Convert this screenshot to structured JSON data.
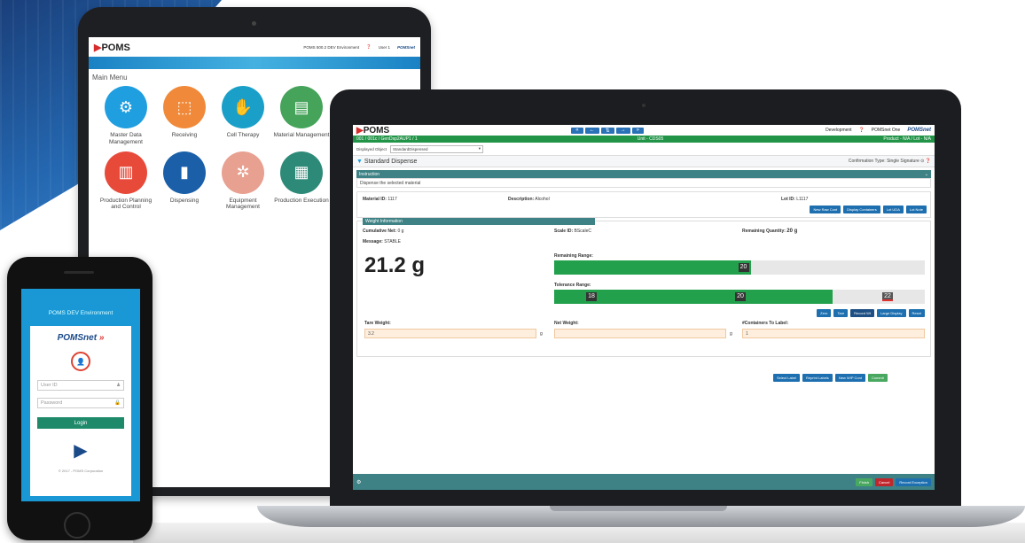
{
  "tablet": {
    "brand": "POMS",
    "env": "POMS 500.2 DEV Environment",
    "user": "User 1",
    "poms_net": "POMSnet",
    "menu_title": "Main Menu",
    "tiles": [
      {
        "label": "Master Data Management",
        "color": "#1f9ee0",
        "glyph": "⚙"
      },
      {
        "label": "Receiving",
        "color": "#f08a3a",
        "glyph": "⬚"
      },
      {
        "label": "Cell Therapy",
        "color": "#1aa0c8",
        "glyph": "✋"
      },
      {
        "label": "Material Management",
        "color": "#45a35a",
        "glyph": "▤"
      },
      {
        "label": "Production Planning and Control",
        "color": "#e84a3a",
        "glyph": "▥"
      },
      {
        "label": "Dispensing",
        "color": "#1a5fa8",
        "glyph": "▮"
      },
      {
        "label": "Equipment Management",
        "color": "#e8a090",
        "glyph": "✲"
      },
      {
        "label": "Production Execution",
        "color": "#2e8a78",
        "glyph": "▦"
      }
    ]
  },
  "phone": {
    "env": "POMS DEV Environment",
    "logo": "POMSnet",
    "user_placeholder": "User ID",
    "password_placeholder": "Password",
    "login_label": "Login",
    "copyright": "© 2017 - POMS Corporation"
  },
  "app": {
    "brand": "POMS",
    "nav": [
      "«",
      "←",
      "⇅",
      "→",
      "»"
    ],
    "environment": "Development",
    "user": "POMSnet One",
    "poms_net": "POMSnet",
    "breadcrumb": "001 / 001c / GenDsp2AUP1 / 1",
    "unit": "Unit - CDS05",
    "product": "Product - N/A / Lot - N/A",
    "displayed_object_label": "Displayed Object",
    "displayed_object_value": "StandardDispensed",
    "form_title": "Standard Dispense",
    "confirmation_label": "Confirmation Type:",
    "confirmation_value": "Single Signature",
    "instruction_header": "Instruction",
    "instruction_text": "Dispense the selected material",
    "material_id_label": "Material ID:",
    "material_id": "1117",
    "description_label": "Description:",
    "description": "Alcohol",
    "lot_id_label": "Lot ID:",
    "lot_id": "L1117",
    "material_buttons": [
      "New Raw Cont",
      "Display Containers",
      "Lot UDA",
      "Lot Note"
    ],
    "weight_header": "Weight Information",
    "cumulative_label": "Cumulative Net:",
    "cumulative_value": "0 g",
    "scale_label": "Scale ID:",
    "scale_value": "BScaleC",
    "remaining_qty_label": "Remaining Quantity:",
    "remaining_qty_value": "20 g",
    "message_label": "Message:",
    "message_value": "STABLE",
    "weight_display": "21.2 g",
    "remaining_range_label": "Remaining Range:",
    "remaining_range_fill": 0.53,
    "remaining_tick": "20",
    "tolerance_range_label": "Tolerance Range:",
    "tolerance_fill": 0.75,
    "tolerance_ticks": [
      "18",
      "20",
      "22"
    ],
    "weight_buttons": [
      "Zero",
      "Tare",
      "Record Wt",
      "Large Display",
      "Reset"
    ],
    "tare_label": "Tare Weight:",
    "tare_value": "3.2",
    "net_label": "Net Weight:",
    "net_value": "",
    "containers_label": "#Containers To Label:",
    "containers_value": "1",
    "unit_g": "g",
    "action_buttons": [
      "Select Label",
      "Reprint Labels",
      "New WIP Cont",
      "Commit"
    ],
    "footer_buttons": [
      "Finish",
      "Cancel",
      "Record Exception"
    ]
  }
}
